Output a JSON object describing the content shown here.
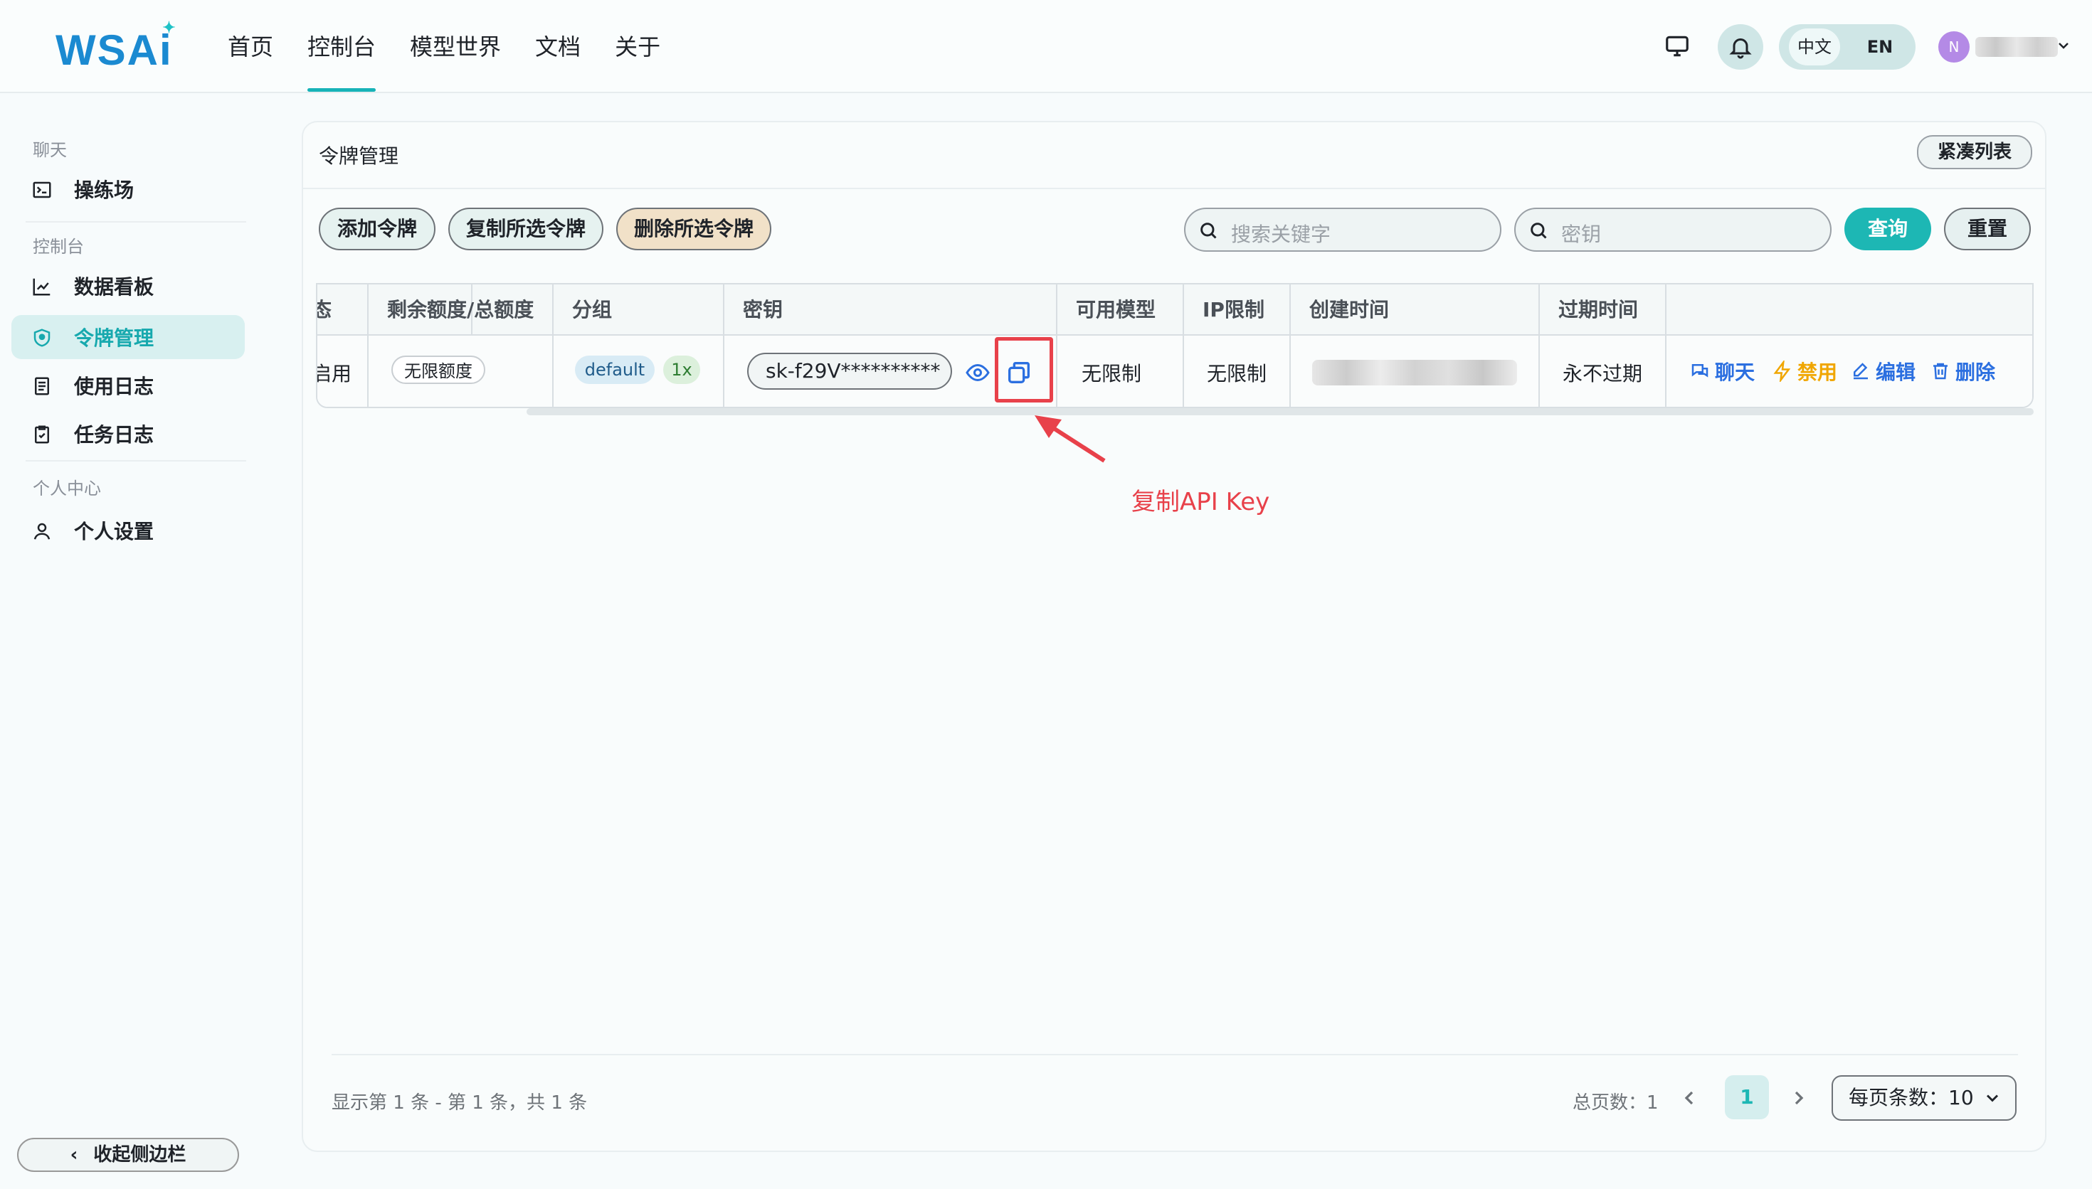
{
  "header": {
    "logo": "WSAi",
    "nav": [
      "首页",
      "控制台",
      "模型世界",
      "文档",
      "关于"
    ],
    "active_nav": "控制台",
    "lang_zh": "中文",
    "lang_en": "EN",
    "avatar_initial": "N"
  },
  "sidebar": {
    "sections": [
      {
        "title": "聊天",
        "items": [
          {
            "label": "操练场",
            "icon": "terminal-icon"
          }
        ]
      },
      {
        "title": "控制台",
        "items": [
          {
            "label": "数据看板",
            "icon": "chart-icon"
          },
          {
            "label": "令牌管理",
            "icon": "shield-icon",
            "active": true
          },
          {
            "label": "使用日志",
            "icon": "document-icon"
          },
          {
            "label": "任务日志",
            "icon": "task-check-icon"
          }
        ]
      },
      {
        "title": "个人中心",
        "items": [
          {
            "label": "个人设置",
            "icon": "user-icon"
          }
        ]
      }
    ],
    "collapse_label": "收起侧边栏"
  },
  "main": {
    "title": "令牌管理",
    "compact_label": "紧凑列表",
    "toolbar": {
      "add": "添加令牌",
      "copy_selected": "复制所选令牌",
      "delete_selected": "删除所选令牌",
      "search_keyword_placeholder": "搜索关键字",
      "search_key_placeholder": "密钥",
      "query": "查询",
      "reset": "重置"
    },
    "table": {
      "columns": [
        "态",
        "剩余额度/总额度",
        "分组",
        "密钥",
        "可用模型",
        "IP限制",
        "创建时间",
        "过期时间",
        ""
      ],
      "rows": [
        {
          "status": "启用",
          "quota": "无限额度",
          "group": "default",
          "ratio": "1x",
          "key": "sk-f29V**********",
          "models": "无限制",
          "ip": "无限制",
          "expire": "永不过期",
          "actions": {
            "chat": "聊天",
            "disable": "禁用",
            "edit": "编辑",
            "delete": "删除"
          }
        }
      ]
    },
    "annotation": "复制API Key",
    "footer": {
      "info": "显示第 1 条 - 第 1 条，共 1 条",
      "total_pages": "总页数：1",
      "current_page": "1",
      "per_page": "每页条数：10"
    }
  },
  "colors": {
    "accent": "#1db7b4",
    "danger": "#e8414a",
    "link": "#2b6fe0",
    "warning": "#f0a600"
  }
}
